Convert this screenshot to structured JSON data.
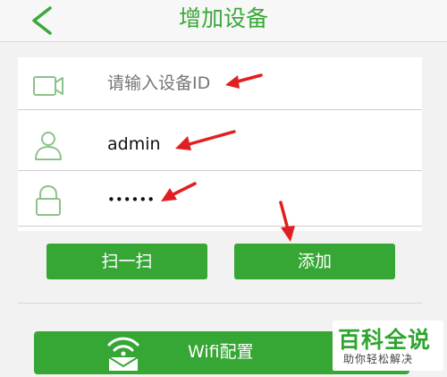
{
  "header": {
    "title": "增加设备",
    "back_icon": "chevron-left-icon"
  },
  "form": {
    "device_id": {
      "placeholder": "请输入设备ID",
      "value": "",
      "icon": "camera-icon"
    },
    "username": {
      "value": "admin",
      "icon": "user-icon"
    },
    "password": {
      "value": "••••••",
      "icon": "lock-icon"
    }
  },
  "buttons": {
    "scan_label": "扫一扫",
    "add_label": "添加",
    "wifi_label": "Wifi配置",
    "wifi_icon": "wifi-envelope-icon"
  },
  "watermark": {
    "title": "百科全说",
    "subtitle": "助你轻松解决"
  },
  "colors": {
    "accent": "#36a635",
    "annotation": "#e02020",
    "background": "#f2f2f2"
  }
}
